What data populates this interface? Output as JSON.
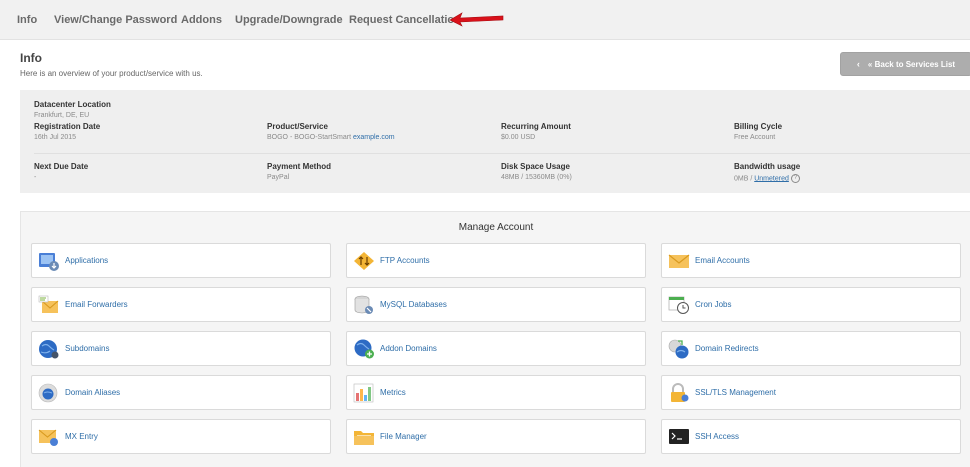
{
  "nav": {
    "tabs": [
      {
        "label": "Info"
      },
      {
        "label": "View/Change Password"
      },
      {
        "label": "Addons"
      },
      {
        "label": "Upgrade/Downgrade"
      },
      {
        "label": "Request Cancellation"
      }
    ],
    "annotation_color": "#d9111a"
  },
  "header": {
    "title": "Info",
    "subtitle": "Here is an overview of your product/service with us.",
    "back_button": "« Back to Services List"
  },
  "info": {
    "datacenter": {
      "label": "Datacenter Location",
      "value": "Frankfurt, DE, EU"
    },
    "registration": {
      "label": "Registration Date",
      "value": "16th Jul 2015"
    },
    "product": {
      "label": "Product/Service",
      "value": "BOGO - BOGO-StartSmart ",
      "link": "example.com"
    },
    "recurring": {
      "label": "Recurring Amount",
      "value": "$0.00 USD"
    },
    "billing": {
      "label": "Billing Cycle",
      "value": "Free Account"
    },
    "due": {
      "label": "Next Due Date",
      "value": "-"
    },
    "payment": {
      "label": "Payment Method",
      "value": "PayPal"
    },
    "disk": {
      "label": "Disk Space Usage",
      "value": "48MB / 15360MB (0%)"
    },
    "bandwidth": {
      "label": "Bandwidth usage",
      "value": "0MB / ",
      "link": "Unmetered",
      "help_icon": "question-circle-icon"
    }
  },
  "manage": {
    "title": "Manage Account",
    "items": [
      {
        "label": "Applications",
        "icon": "applications-icon"
      },
      {
        "label": "FTP Accounts",
        "icon": "ftp-icon"
      },
      {
        "label": "Email Accounts",
        "icon": "email-icon"
      },
      {
        "label": "Email Forwarders",
        "icon": "email-forwarder-icon"
      },
      {
        "label": "MySQL Databases",
        "icon": "database-icon"
      },
      {
        "label": "Cron Jobs",
        "icon": "cron-icon"
      },
      {
        "label": "Subdomains",
        "icon": "globe-icon"
      },
      {
        "label": "Addon Domains",
        "icon": "globe-add-icon"
      },
      {
        "label": "Domain Redirects",
        "icon": "globe-redirect-icon"
      },
      {
        "label": "Domain Aliases",
        "icon": "globe-alias-icon"
      },
      {
        "label": "Metrics",
        "icon": "metrics-icon"
      },
      {
        "label": "SSL/TLS Management",
        "icon": "ssl-lock-icon"
      },
      {
        "label": "MX Entry",
        "icon": "mx-icon"
      },
      {
        "label": "File Manager",
        "icon": "folder-icon"
      },
      {
        "label": "SSH Access",
        "icon": "terminal-icon"
      }
    ]
  }
}
